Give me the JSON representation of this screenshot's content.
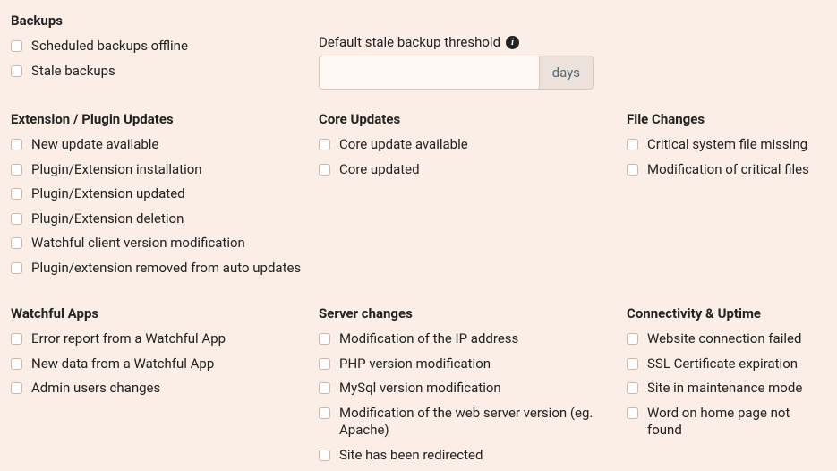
{
  "backups": {
    "title": "Backups",
    "items": [
      "Scheduled backups offline",
      "Stale backups"
    ],
    "threshold_label": "Default stale backup threshold",
    "threshold_value": "",
    "threshold_unit": "days"
  },
  "extension_updates": {
    "title": "Extension / Plugin Updates",
    "items": [
      "New update available",
      "Plugin/Extension installation",
      "Plugin/Extension updated",
      "Plugin/Extension deletion",
      "Watchful client version modification",
      "Plugin/extension removed from auto updates"
    ]
  },
  "core_updates": {
    "title": "Core Updates",
    "items": [
      "Core update available",
      "Core updated"
    ]
  },
  "file_changes": {
    "title": "File Changes",
    "items": [
      "Critical system file missing",
      "Modification of critical files"
    ]
  },
  "watchful_apps": {
    "title": "Watchful Apps",
    "items": [
      "Error report from a Watchful App",
      "New data from a Watchful App",
      "Admin users changes"
    ]
  },
  "server_changes": {
    "title": "Server changes",
    "items": [
      "Modification of the IP address",
      "PHP version modification",
      "MySql version modification",
      "Modification of the web server version (eg. Apache)",
      "Site has been redirected"
    ]
  },
  "connectivity": {
    "title": "Connectivity & Uptime",
    "items": [
      "Website connection failed",
      "SSL Certificate expiration",
      "Site in maintenance mode",
      "Word on home page not found"
    ]
  }
}
